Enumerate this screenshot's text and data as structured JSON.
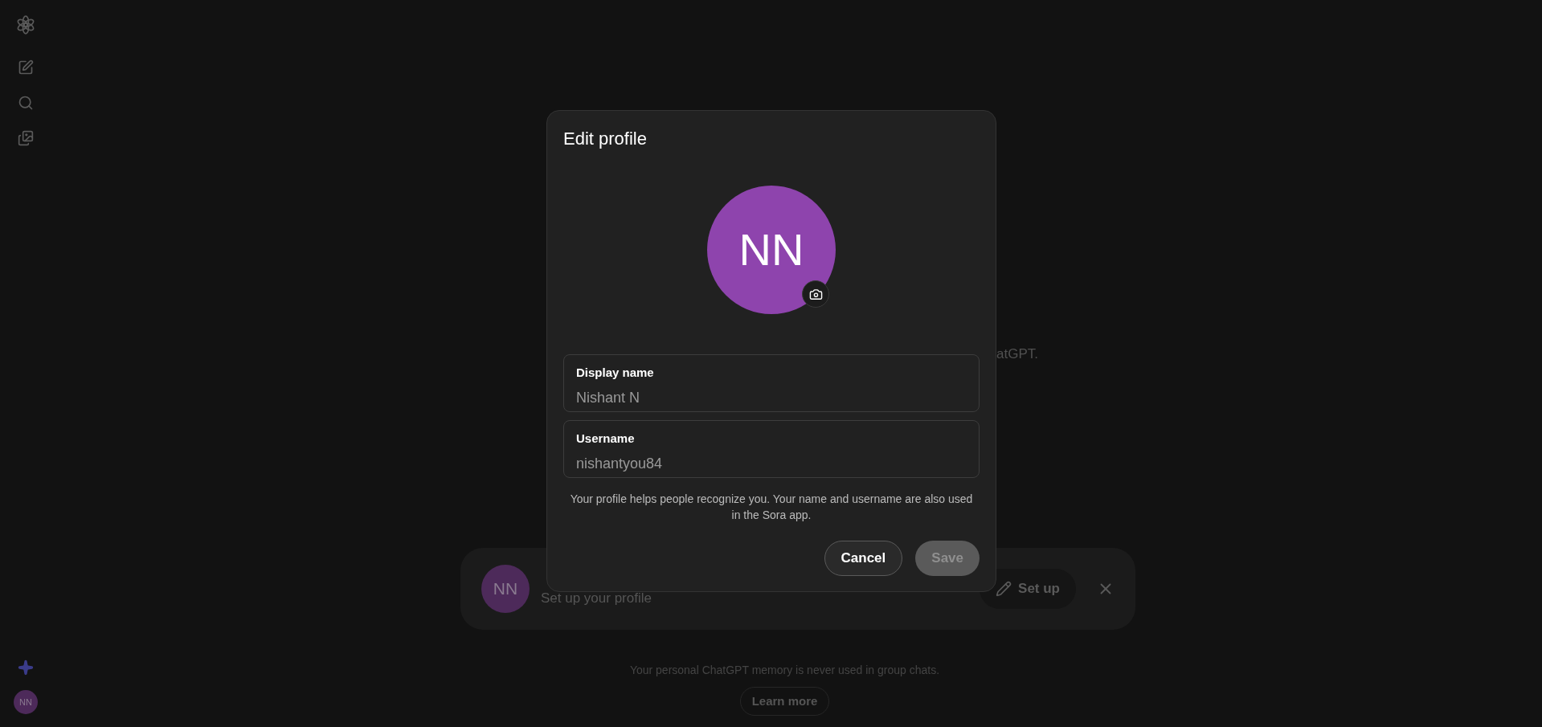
{
  "background": {
    "text_fragment": "atGPT.",
    "banner": {
      "avatar": "NN",
      "subtitle": "Set up your profile",
      "button": "Set up"
    },
    "note": "Your personal ChatGPT memory is never used in group chats.",
    "link": "Learn more"
  },
  "sidebar": {
    "avatar": "NN"
  },
  "dialog": {
    "title": "Edit profile",
    "avatar": "NN",
    "fields": [
      {
        "label": "Display name",
        "value": "Nishant N"
      },
      {
        "label": "Username",
        "value": "nishantyou84"
      }
    ],
    "help": "Your profile helps people recognize you. Your name and username are also used in the Sora app.",
    "buttons": [
      {
        "label": "Cancel",
        "kind": "secondary",
        "disabled": false
      },
      {
        "label": "Save",
        "kind": "primary",
        "disabled": true
      }
    ]
  }
}
